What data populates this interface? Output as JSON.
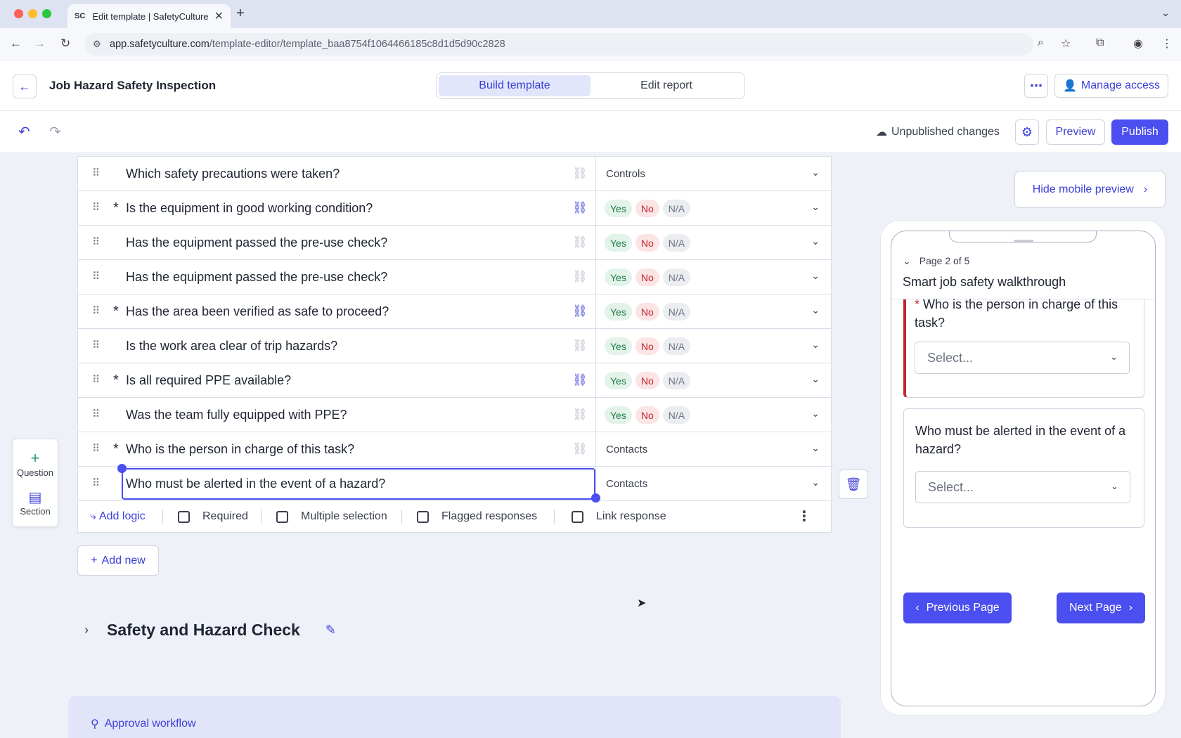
{
  "browser": {
    "tab_title": "Edit template | SafetyCulture",
    "tab_favicon": "SC",
    "url_host": "app.safetyculture.com",
    "url_path": "/template-editor/template_baa8754f1064466185c8d1d5d90c2828"
  },
  "header": {
    "template_title": "Job Hazard Safety Inspection",
    "modes": [
      "Build template",
      "Edit report"
    ],
    "manage_access": "Manage access"
  },
  "toolbar": {
    "status": "Unpublished changes",
    "preview": "Preview",
    "publish": "Publish"
  },
  "questions": [
    {
      "text": "Which safety precautions were taken?",
      "required": false,
      "linked": false,
      "response_type": "text",
      "response": "Controls"
    },
    {
      "text": "Is the equipment in good working condition?",
      "required": true,
      "linked": true,
      "response_type": "yesno"
    },
    {
      "text": "Has the equipment passed the pre-use check?",
      "required": false,
      "linked": false,
      "response_type": "yesno"
    },
    {
      "text": "Has the equipment passed the pre-use check?",
      "required": false,
      "linked": false,
      "response_type": "yesno"
    },
    {
      "text": "Has the area been verified as safe to proceed?",
      "required": true,
      "linked": true,
      "response_type": "yesno"
    },
    {
      "text": "Is the work area clear of trip hazards?",
      "required": false,
      "linked": false,
      "response_type": "yesno"
    },
    {
      "text": "Is all required PPE available?",
      "required": true,
      "linked": true,
      "response_type": "yesno"
    },
    {
      "text": "Was the team fully equipped with PPE?",
      "required": false,
      "linked": false,
      "response_type": "yesno"
    },
    {
      "text": "Who is the person in charge of this task?",
      "required": true,
      "linked": false,
      "response_type": "text",
      "response": "Contacts"
    },
    {
      "text": "Who must be alerted in the event of a hazard?",
      "required": false,
      "linked": false,
      "response_type": "text",
      "response": "Contacts",
      "editing": true
    }
  ],
  "yesno_labels": {
    "yes": "Yes",
    "no": "No",
    "na": "N/A"
  },
  "options_bar": {
    "add_logic": "Add logic",
    "required": "Required",
    "multiple_selection": "Multiple selection",
    "flagged_responses": "Flagged responses",
    "link_response": "Link response"
  },
  "side_panel": {
    "question": "Question",
    "section": "Section"
  },
  "add_new": "Add new",
  "section": {
    "title": "Safety and Hazard Check"
  },
  "approval": {
    "label": "Approval workflow"
  },
  "mobile_preview": {
    "hide_button": "Hide mobile preview",
    "page_info": "Page 2 of 5",
    "page_title": "Smart job safety walkthrough",
    "questions": [
      {
        "text": "Who is the person in charge of this task?",
        "required": true,
        "placeholder": "Select..."
      },
      {
        "text": "Who must be alerted in the event of a hazard?",
        "required": false,
        "placeholder": "Select..."
      }
    ],
    "prev": "Previous Page",
    "next": "Next Page"
  },
  "colors": {
    "accent": "#4b4ff0",
    "yes": "#1e7c47",
    "no": "#c0262d",
    "required_marker": "#c0262d"
  }
}
